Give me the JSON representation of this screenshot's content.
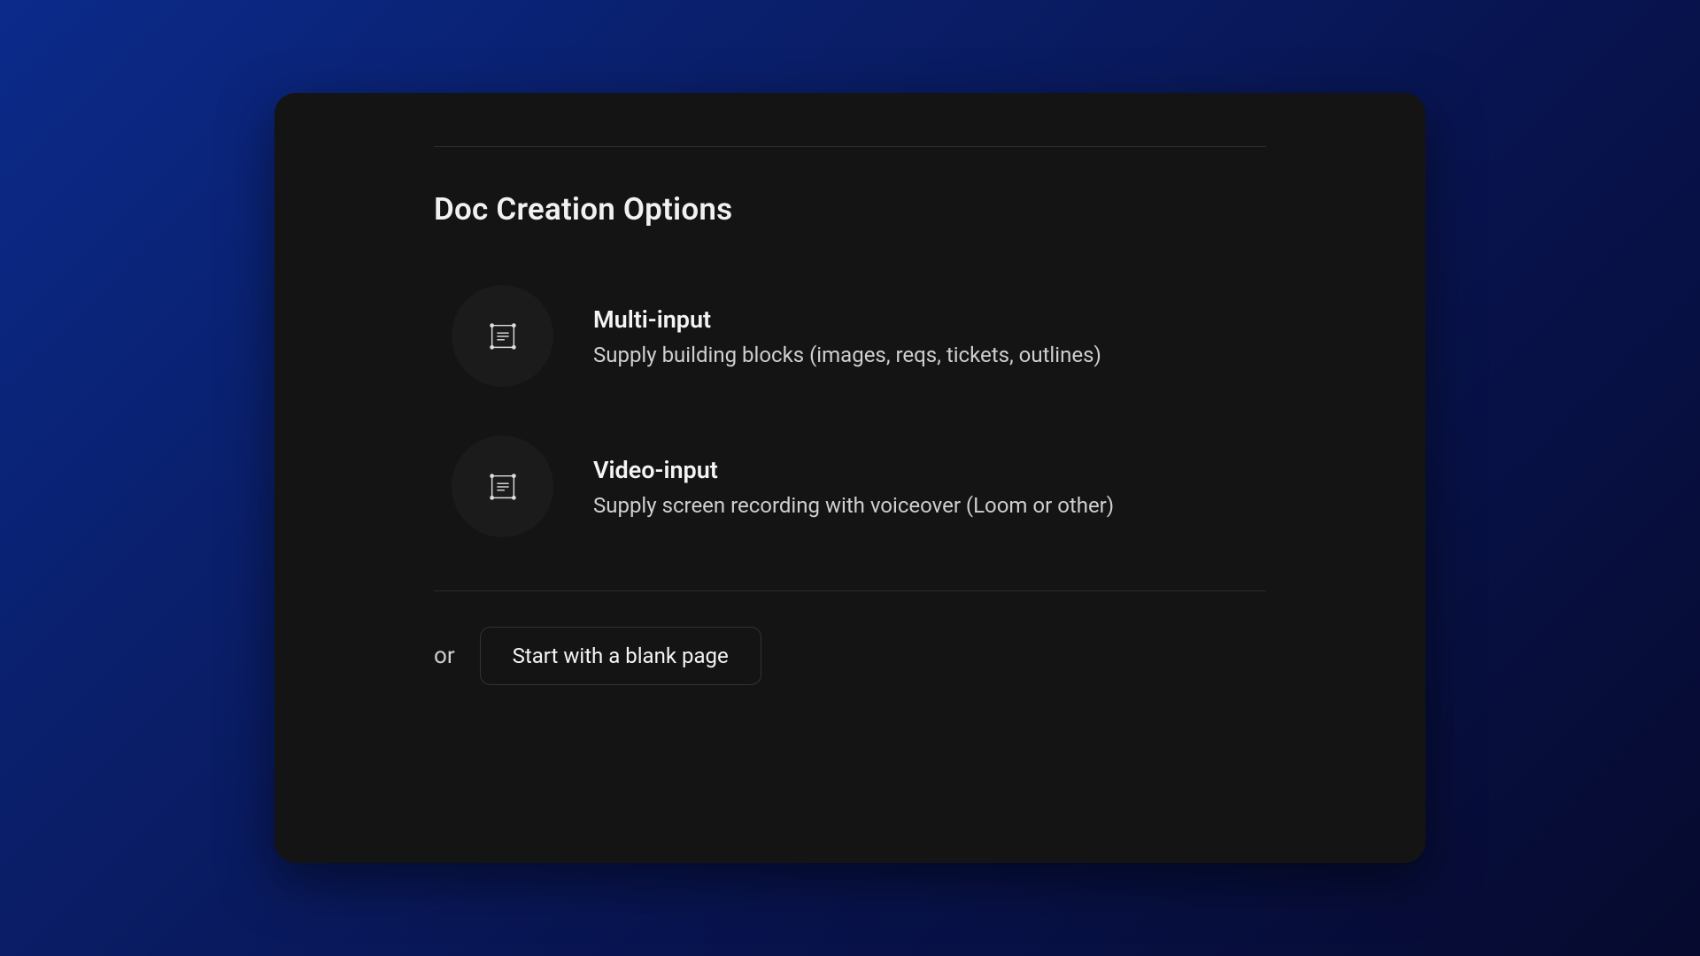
{
  "header": {
    "title": "Doc Creation Options"
  },
  "options": [
    {
      "title": "Multi-input",
      "description": "Supply building blocks (images, reqs, tickets, outlines)"
    },
    {
      "title": "Video-input",
      "description": "Supply screen recording with voiceover (Loom or other)"
    }
  ],
  "alt": {
    "or_label": "or",
    "blank_button": "Start with a blank page"
  }
}
